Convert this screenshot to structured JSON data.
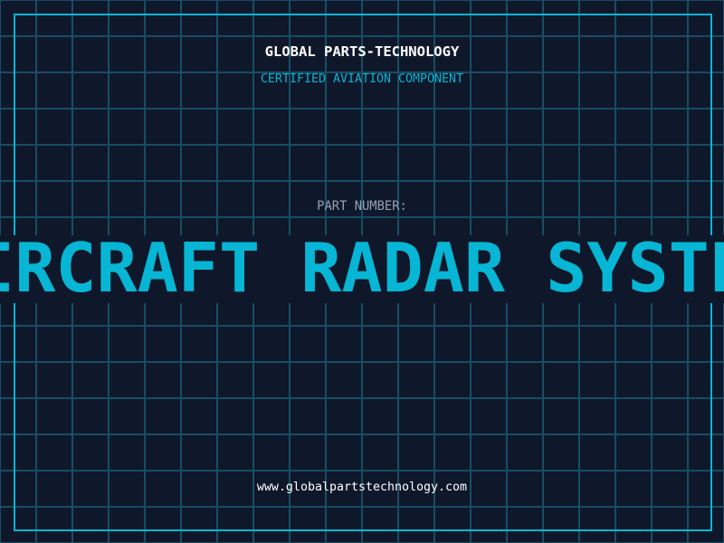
{
  "header": {
    "company": "GLOBAL PARTS-TECHNOLOGY",
    "subtitle": "CERTIFIED AVIATION COMPONENT"
  },
  "part": {
    "label": "PART NUMBER:",
    "value": "AIRCRAFT RADAR SYSTEM"
  },
  "footer": {
    "url": "www.globalpartstechnology.com"
  },
  "colors": {
    "background": "#0f172a",
    "grid": "#164e63",
    "accent": "#06b6d4",
    "label": "#94a3b8",
    "text": "#ffffff"
  }
}
